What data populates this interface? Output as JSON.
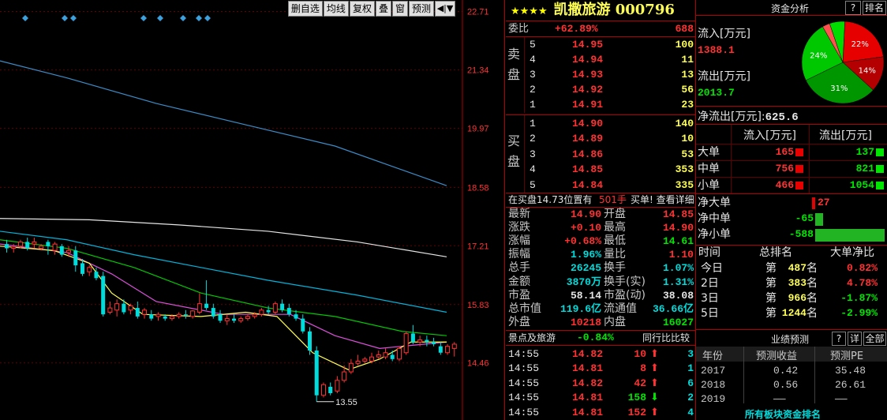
{
  "toolbar": {
    "btn1": "删自选",
    "btn2": "均线",
    "btn3": "复权",
    "btn4": "叠",
    "btn5": "窗",
    "btn6": "预测",
    "btn7": "◀|▼"
  },
  "chart_data": {
    "type": "candlestick",
    "y_ticks": [
      "22.71",
      "21.34",
      "19.97",
      "18.58",
      "17.21",
      "15.83",
      "14.46"
    ],
    "y_values": [
      22.71,
      21.34,
      19.97,
      18.58,
      17.21,
      15.83,
      14.46
    ],
    "ylim": [
      13.25,
      22.83
    ],
    "low_label": "13.55",
    "low_value": 13.55,
    "markers_x_index": [
      1,
      4,
      5,
      11,
      12,
      14,
      15
    ],
    "candles": [
      {
        "o": 17.25,
        "h": 17.35,
        "c": 17.15,
        "l": 17.05
      },
      {
        "o": 17.15,
        "h": 17.25,
        "c": 17.18,
        "l": 17.05
      },
      {
        "o": 17.2,
        "h": 17.35,
        "c": 17.3,
        "l": 17.15
      },
      {
        "o": 17.3,
        "h": 17.4,
        "c": 17.15,
        "l": 17.1
      },
      {
        "o": 17.25,
        "h": 17.4,
        "c": 17.3,
        "l": 17.15
      },
      {
        "o": 17.15,
        "h": 17.25,
        "c": 17.2,
        "l": 17.1
      },
      {
        "o": 17.3,
        "h": 17.35,
        "c": 17.2,
        "l": 17.0
      },
      {
        "o": 17.1,
        "h": 17.3,
        "c": 17.25,
        "l": 17.0
      },
      {
        "o": 17.2,
        "h": 17.25,
        "c": 17.0,
        "l": 16.95
      },
      {
        "o": 17.05,
        "h": 17.2,
        "c": 17.1,
        "l": 16.95
      },
      {
        "o": 17.1,
        "h": 17.2,
        "c": 16.75,
        "l": 16.6
      },
      {
        "o": 16.8,
        "h": 16.9,
        "c": 16.55,
        "l": 16.5
      },
      {
        "o": 16.6,
        "h": 16.75,
        "c": 16.7,
        "l": 16.5
      },
      {
        "o": 16.6,
        "h": 16.7,
        "c": 16.45,
        "l": 16.4
      },
      {
        "o": 16.5,
        "h": 16.6,
        "c": 15.6,
        "l": 15.55
      },
      {
        "o": 15.65,
        "h": 15.9,
        "c": 15.75,
        "l": 15.6
      },
      {
        "o": 15.7,
        "h": 15.95,
        "c": 15.85,
        "l": 15.55
      },
      {
        "o": 15.85,
        "h": 15.95,
        "c": 15.65,
        "l": 15.6
      },
      {
        "o": 15.7,
        "h": 15.85,
        "c": 15.8,
        "l": 15.6
      },
      {
        "o": 15.75,
        "h": 15.9,
        "c": 15.55,
        "l": 15.5
      },
      {
        "o": 15.6,
        "h": 15.75,
        "c": 15.7,
        "l": 15.5
      },
      {
        "o": 15.6,
        "h": 15.7,
        "c": 15.5,
        "l": 15.45
      },
      {
        "o": 15.55,
        "h": 15.65,
        "c": 15.6,
        "l": 15.45
      },
      {
        "o": 15.55,
        "h": 15.6,
        "c": 15.5,
        "l": 15.45
      },
      {
        "o": 15.5,
        "h": 15.6,
        "c": 15.55,
        "l": 15.45
      },
      {
        "o": 15.55,
        "h": 15.65,
        "c": 15.6,
        "l": 15.5
      },
      {
        "o": 15.6,
        "h": 15.7,
        "c": 15.58,
        "l": 15.5
      },
      {
        "o": 15.55,
        "h": 15.7,
        "c": 15.68,
        "l": 15.5
      },
      {
        "o": 15.65,
        "h": 16.1,
        "c": 15.85,
        "l": 15.6
      },
      {
        "o": 15.85,
        "h": 16.4,
        "c": 15.75,
        "l": 15.7
      },
      {
        "o": 15.75,
        "h": 15.85,
        "c": 15.55,
        "l": 15.5
      },
      {
        "o": 15.6,
        "h": 15.7,
        "c": 15.45,
        "l": 15.4
      },
      {
        "o": 15.45,
        "h": 15.6,
        "c": 15.5,
        "l": 15.35
      },
      {
        "o": 15.5,
        "h": 15.6,
        "c": 15.45,
        "l": 15.4
      },
      {
        "o": 15.45,
        "h": 15.55,
        "c": 15.5,
        "l": 15.4
      },
      {
        "o": 15.5,
        "h": 15.6,
        "c": 15.55,
        "l": 15.45
      },
      {
        "o": 15.55,
        "h": 15.65,
        "c": 15.6,
        "l": 15.5
      },
      {
        "o": 15.6,
        "h": 15.75,
        "c": 15.7,
        "l": 15.55
      },
      {
        "o": 15.7,
        "h": 15.8,
        "c": 15.65,
        "l": 15.6
      },
      {
        "o": 15.65,
        "h": 15.9,
        "c": 15.85,
        "l": 15.6
      },
      {
        "o": 15.85,
        "h": 15.95,
        "c": 15.7,
        "l": 15.65
      },
      {
        "o": 15.75,
        "h": 15.85,
        "c": 15.6,
        "l": 15.55
      },
      {
        "o": 15.6,
        "h": 15.7,
        "c": 15.5,
        "l": 15.45
      },
      {
        "o": 15.5,
        "h": 15.6,
        "c": 15.2,
        "l": 15.15
      },
      {
        "o": 15.2,
        "h": 15.3,
        "c": 14.75,
        "l": 14.65
      },
      {
        "o": 14.75,
        "h": 14.85,
        "c": 13.7,
        "l": 13.55
      },
      {
        "o": 13.7,
        "h": 14.0,
        "c": 13.95,
        "l": 13.65
      },
      {
        "o": 13.9,
        "h": 14.0,
        "c": 13.75,
        "l": 13.7
      },
      {
        "o": 13.8,
        "h": 14.15,
        "c": 14.05,
        "l": 13.75
      },
      {
        "o": 14.05,
        "h": 14.4,
        "c": 14.25,
        "l": 14.0
      },
      {
        "o": 14.25,
        "h": 14.55,
        "c": 14.45,
        "l": 14.2
      },
      {
        "o": 14.45,
        "h": 14.65,
        "c": 14.5,
        "l": 14.4
      },
      {
        "o": 14.5,
        "h": 14.6,
        "c": 14.55,
        "l": 14.45
      },
      {
        "o": 14.5,
        "h": 14.7,
        "c": 14.6,
        "l": 14.45
      },
      {
        "o": 14.6,
        "h": 14.75,
        "c": 14.65,
        "l": 14.55
      },
      {
        "o": 14.6,
        "h": 14.8,
        "c": 14.7,
        "l": 14.55
      },
      {
        "o": 14.65,
        "h": 14.75,
        "c": 14.55,
        "l": 14.5
      },
      {
        "o": 14.55,
        "h": 14.85,
        "c": 14.8,
        "l": 14.5
      },
      {
        "o": 14.7,
        "h": 15.2,
        "c": 15.15,
        "l": 14.65
      },
      {
        "o": 15.15,
        "h": 15.35,
        "c": 14.95,
        "l": 14.9
      },
      {
        "o": 14.95,
        "h": 15.1,
        "c": 15.0,
        "l": 14.85
      },
      {
        "o": 15.0,
        "h": 15.1,
        "c": 14.95,
        "l": 14.85
      },
      {
        "o": 14.95,
        "h": 15.05,
        "c": 14.9,
        "l": 14.85
      },
      {
        "o": 14.85,
        "h": 14.95,
        "c": 14.7,
        "l": 14.65
      },
      {
        "o": 14.7,
        "h": 14.9,
        "c": 14.85,
        "l": 14.65
      },
      {
        "o": 14.8,
        "h": 14.95,
        "c": 14.9,
        "l": 14.61
      }
    ],
    "ma_lines": [
      {
        "color": "#3c8cc8",
        "points": [
          [
            0,
            21.55
          ],
          [
            0.15,
            21.15
          ],
          [
            0.35,
            20.55
          ],
          [
            0.55,
            20.05
          ],
          [
            0.75,
            19.55
          ],
          [
            1.0,
            18.62
          ]
        ]
      },
      {
        "color": "#e6e6e6",
        "points": [
          [
            0,
            17.85
          ],
          [
            0.2,
            17.82
          ],
          [
            0.4,
            17.7
          ],
          [
            0.6,
            17.55
          ],
          [
            0.8,
            17.3
          ],
          [
            1.0,
            16.95
          ]
        ]
      },
      {
        "color": "#00b4dc",
        "points": [
          [
            0,
            17.55
          ],
          [
            0.15,
            17.35
          ],
          [
            0.3,
            17.0
          ],
          [
            0.45,
            16.7
          ],
          [
            0.6,
            16.4
          ],
          [
            0.8,
            16.05
          ],
          [
            1.0,
            15.65
          ]
        ]
      },
      {
        "color": "#00c800",
        "points": [
          [
            0,
            17.35
          ],
          [
            0.15,
            17.15
          ],
          [
            0.3,
            16.7
          ],
          [
            0.45,
            16.1
          ],
          [
            0.6,
            15.75
          ],
          [
            0.75,
            15.55
          ],
          [
            0.9,
            15.2
          ],
          [
            1.0,
            15.1
          ]
        ]
      },
      {
        "color": "#dc50dc",
        "points": [
          [
            0,
            17.25
          ],
          [
            0.15,
            17.05
          ],
          [
            0.25,
            16.55
          ],
          [
            0.35,
            15.9
          ],
          [
            0.5,
            15.6
          ],
          [
            0.65,
            15.6
          ],
          [
            0.75,
            15.1
          ],
          [
            0.85,
            14.8
          ],
          [
            1.0,
            14.95
          ]
        ]
      },
      {
        "color": "#ffff54",
        "points": [
          [
            0,
            17.2
          ],
          [
            0.12,
            17.1
          ],
          [
            0.2,
            16.8
          ],
          [
            0.25,
            16.1
          ],
          [
            0.32,
            15.6
          ],
          [
            0.45,
            15.55
          ],
          [
            0.55,
            15.65
          ],
          [
            0.62,
            15.55
          ],
          [
            0.7,
            14.7
          ],
          [
            0.78,
            14.3
          ],
          [
            0.85,
            14.55
          ],
          [
            0.92,
            14.95
          ],
          [
            1.0,
            14.95
          ]
        ]
      }
    ]
  },
  "quote": {
    "stars": "★★★★",
    "title": "凯撒旅游 000796",
    "weibi_label": "委比",
    "weibi_pct": "+62.89%",
    "weibi_val": "688",
    "sell_label": "卖盘",
    "sell_label_1": "卖",
    "sell_label_2": "盘",
    "buy_label_1": "买",
    "buy_label_2": "盘",
    "sells": [
      {
        "lvl": "5",
        "price": "14.95",
        "vol": "100"
      },
      {
        "lvl": "4",
        "price": "14.94",
        "vol": "11"
      },
      {
        "lvl": "3",
        "price": "14.93",
        "vol": "13"
      },
      {
        "lvl": "2",
        "price": "14.92",
        "vol": "56"
      },
      {
        "lvl": "1",
        "price": "14.91",
        "vol": "23"
      }
    ],
    "buys": [
      {
        "lvl": "1",
        "price": "14.90",
        "vol": "140"
      },
      {
        "lvl": "2",
        "price": "14.89",
        "vol": "10"
      },
      {
        "lvl": "3",
        "price": "14.86",
        "vol": "53"
      },
      {
        "lvl": "4",
        "price": "14.85",
        "vol": "353"
      },
      {
        "lvl": "5",
        "price": "14.84",
        "vol": "335"
      }
    ],
    "notice_left": "在买盘14.73位置有",
    "notice_vol": "501手",
    "notice_right": "买单! 查看详细",
    "stats": [
      {
        "l1": "最新",
        "v1": "14.90",
        "c1": "red",
        "l2": "开盘",
        "v2": "14.85",
        "c2": "red"
      },
      {
        "l1": "涨跌",
        "v1": "+0.10",
        "c1": "red",
        "l2": "最高",
        "v2": "14.90",
        "c2": "red"
      },
      {
        "l1": "涨幅",
        "v1": "+0.68%",
        "c1": "red",
        "l2": "最低",
        "v2": "14.61",
        "c2": "grn"
      },
      {
        "l1": "振幅",
        "v1": "1.96%",
        "c1": "cyn",
        "l2": "量比",
        "v2": "1.10",
        "c2": "red"
      },
      {
        "l1": "总手",
        "v1": "26245",
        "c1": "cyn",
        "l2": "换手",
        "v2": "1.07%",
        "c2": "cyn"
      },
      {
        "l1": "金额",
        "v1": "3870万",
        "c1": "cyn",
        "l2": "换手(实)",
        "v2": "1.31%",
        "c2": "cyn"
      },
      {
        "l1": "市盈",
        "v1": "58.14",
        "c1": "wht",
        "l2": "市盈(动)",
        "v2": "38.08",
        "c2": "wht"
      },
      {
        "l1": "总市值",
        "v1": "119.6亿",
        "c1": "cyn",
        "l2": "流通值",
        "v2": "36.66亿",
        "c2": "cyn"
      },
      {
        "l1": "外盘",
        "v1": "10218",
        "c1": "red",
        "l2": "内盘",
        "v2": "16027",
        "c2": "grn"
      }
    ],
    "sector_name": "景点及旅游",
    "sector_pct": "-0.84%",
    "compare_btn": "同行比比较",
    "ticks": [
      {
        "time": "14:55",
        "price": "14.82",
        "vol": "10",
        "dir": "up",
        "n": "3"
      },
      {
        "time": "14:55",
        "price": "14.81",
        "vol": "8",
        "dir": "up",
        "n": "1"
      },
      {
        "time": "14:55",
        "price": "14.82",
        "vol": "42",
        "dir": "up",
        "n": "6"
      },
      {
        "time": "14:55",
        "price": "14.81",
        "vol": "158",
        "dir": "down",
        "n": "2"
      },
      {
        "time": "14:55",
        "price": "14.81",
        "vol": "152",
        "dir": "up",
        "n": "4"
      }
    ]
  },
  "funds": {
    "title": "资金分析",
    "help_btn": "?",
    "rank_btn": "排名",
    "inflow_label": "流入[万元]",
    "inflow_val": "1388.1",
    "outflow_label": "流出[万元]",
    "outflow_val": "2013.7",
    "net_label": "净流出[万元]:",
    "net_val": "625.6",
    "pie": [
      {
        "label": "22%",
        "value": 22,
        "color": "#e60000"
      },
      {
        "label": "14%",
        "value": 14,
        "color": "#b40000"
      },
      {
        "label": "31%",
        "value": 31,
        "color": "#009600"
      },
      {
        "label": "24%",
        "value": 24,
        "color": "#00c800"
      },
      {
        "label": "",
        "value": 3,
        "color": "#ff5050"
      },
      {
        "label": "",
        "value": 6,
        "color": "#00dc00"
      }
    ],
    "col_in": "流入[万元]",
    "col_out": "流出[万元]",
    "orders": [
      {
        "name": "大单",
        "in": "165",
        "out": "137"
      },
      {
        "name": "中单",
        "in": "756",
        "out": "821"
      },
      {
        "name": "小单",
        "in": "466",
        "out": "1054"
      }
    ],
    "nets": [
      {
        "name": "净大单",
        "val": "27",
        "num": 27
      },
      {
        "name": "净中单",
        "val": "-65",
        "num": -65
      },
      {
        "name": "净小单",
        "val": "-588",
        "num": -588
      }
    ],
    "rank_cols": {
      "time": "时间",
      "rank": "总排名",
      "net": "大单净比"
    },
    "ranks": [
      {
        "period": "今日",
        "prefix": "第",
        "rank": "487",
        "suffix": "名",
        "net": "0.82%",
        "c": "red"
      },
      {
        "period": "2日",
        "prefix": "第",
        "rank": "383",
        "suffix": "名",
        "net": "4.78%",
        "c": "red"
      },
      {
        "period": "3日",
        "prefix": "第",
        "rank": "966",
        "suffix": "名",
        "net": "-1.87%",
        "c": "grn"
      },
      {
        "period": "5日",
        "prefix": "第",
        "rank": "1244",
        "suffix": "名",
        "net": "-2.99%",
        "c": "grn"
      }
    ],
    "forecast_title": "业绩预测",
    "forecast_help": "?",
    "forecast_detail": "详",
    "forecast_all": "全部",
    "forecast_cols": {
      "year": "年份",
      "eps": "预测收益",
      "pe": "预测PE"
    },
    "forecast": [
      {
        "year": "2017",
        "eps": "0.42",
        "pe": "35.48"
      },
      {
        "year": "2018",
        "eps": "0.56",
        "pe": "26.61"
      },
      {
        "year": "2019",
        "eps": "——",
        "pe": "——"
      }
    ],
    "sector_rank": "所有板块资金排名"
  }
}
